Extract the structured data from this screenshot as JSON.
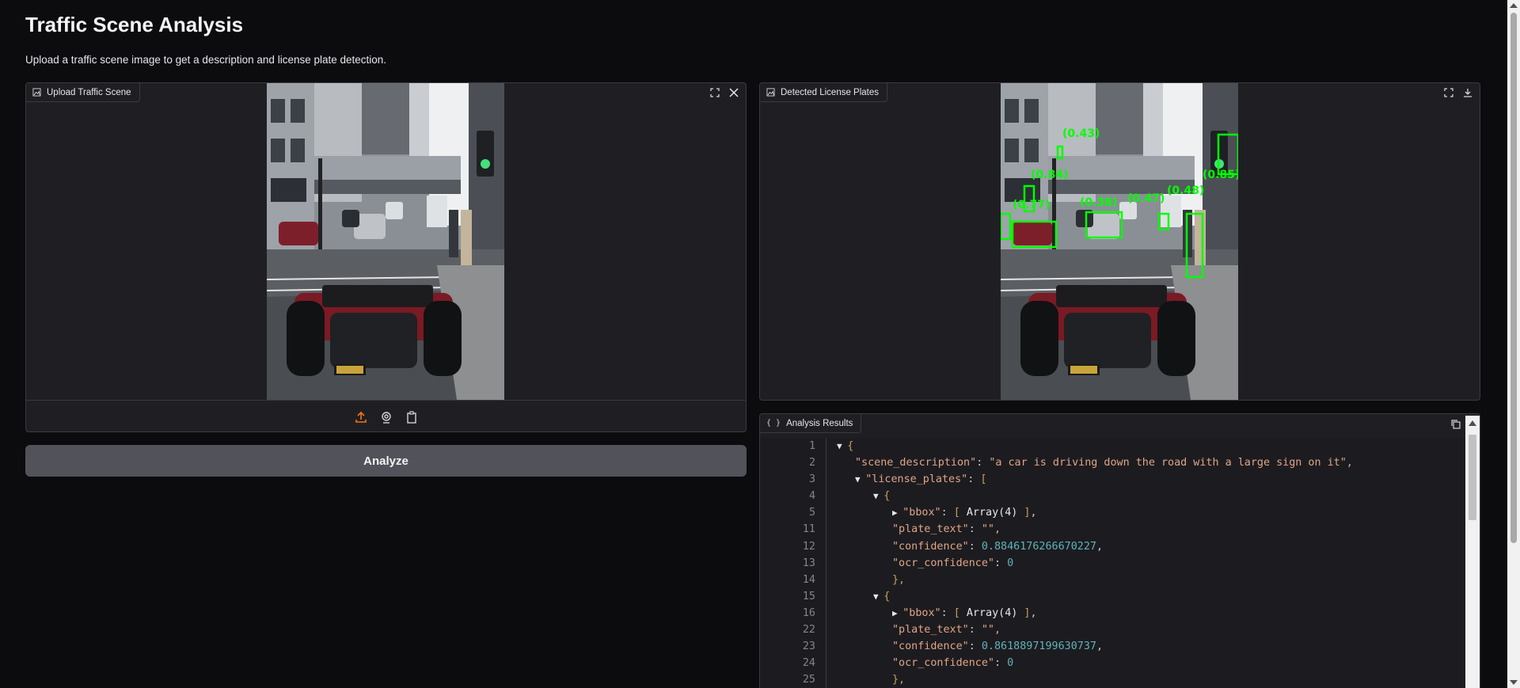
{
  "page": {
    "title": "Traffic Scene Analysis",
    "subtitle": "Upload a traffic scene image to get a description and license plate detection."
  },
  "upload_panel": {
    "label": "Upload Traffic Scene",
    "icons": [
      "image-icon",
      "fullscreen-icon",
      "close-icon",
      "upload-icon",
      "webcam-icon",
      "clipboard-icon"
    ]
  },
  "analyze_button": {
    "label": "Analyze"
  },
  "detect_panel": {
    "label": "Detected License Plates",
    "icons": [
      "image-icon",
      "fullscreen-icon",
      "download-icon"
    ],
    "box_labels": [
      "(0.43)",
      "(0.84)",
      "(0.85)",
      "(0.48)",
      "(0.77)",
      "(0.38)",
      "(0.47)"
    ]
  },
  "results_panel": {
    "label": "Analysis Results",
    "icons": [
      "json-icon",
      "copy-icon"
    ],
    "lines": [
      {
        "n": "1",
        "text": "{"
      },
      {
        "n": "2",
        "key": "\"scene_description\"",
        "value": "\"a car is driving down the road with a large sign on it\","
      },
      {
        "n": "3",
        "key": "\"license_plates\"",
        "value": "["
      },
      {
        "n": "4",
        "text": "{"
      },
      {
        "n": "5",
        "key": "\"bbox\"",
        "value": "Array(4)"
      },
      {
        "n": "11",
        "key": "\"plate_text\"",
        "value": "\"\","
      },
      {
        "n": "12",
        "key": "\"confidence\"",
        "value": "0.8846176266670227"
      },
      {
        "n": "13",
        "key": "\"ocr_confidence\"",
        "value": "0"
      },
      {
        "n": "14",
        "text": "},"
      },
      {
        "n": "15",
        "text": "{"
      },
      {
        "n": "16",
        "key": "\"bbox\"",
        "value": "Array(4)"
      },
      {
        "n": "22",
        "key": "\"plate_text\"",
        "value": "\"\","
      },
      {
        "n": "23",
        "key": "\"confidence\"",
        "value": "0.8618897199630737"
      },
      {
        "n": "24",
        "key": "\"ocr_confidence\"",
        "value": "0"
      },
      {
        "n": "25",
        "text": "},"
      }
    ]
  },
  "colors": {
    "detection_box": "#00ff00",
    "accent_upload": "#f97316"
  }
}
